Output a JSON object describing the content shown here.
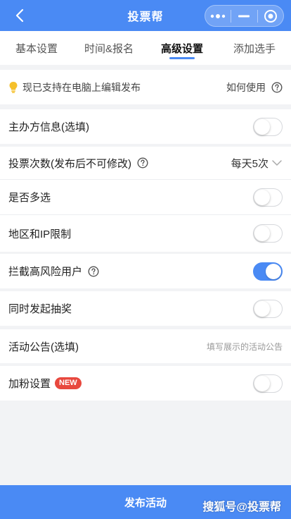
{
  "header": {
    "title": "投票帮",
    "back_icon": "chevron-left-icon",
    "capsule_icons": [
      "more-dots-icon",
      "minimize-icon",
      "close-target-icon"
    ]
  },
  "tabs": [
    {
      "label": "基本设置",
      "active": false
    },
    {
      "label": "时间&报名",
      "active": false
    },
    {
      "label": "高级设置",
      "active": true
    },
    {
      "label": "添加选手",
      "active": false
    }
  ],
  "notice": {
    "text": "现已支持在电脑上编辑发布",
    "link": "如何使用"
  },
  "settings": {
    "organizer": {
      "label": "主办方信息(选填)",
      "on": false
    },
    "vote_count": {
      "label": "投票次数(发布后不可修改)",
      "value": "每天5次"
    },
    "multi": {
      "label": "是否多选",
      "on": false
    },
    "region": {
      "label": "地区和IP限制",
      "on": false
    },
    "risk": {
      "label": "拦截高风险用户",
      "on": true
    },
    "lottery": {
      "label": "同时发起抽奖",
      "on": false
    },
    "announcement": {
      "label": "活动公告(选填)",
      "placeholder": "填写展示的活动公告"
    },
    "fans": {
      "label": "加粉设置",
      "badge": "NEW",
      "on": false
    }
  },
  "footer": {
    "publish": "发布活动",
    "watermark": "搜狐号@投票帮"
  },
  "colors": {
    "brand": "#4a8af4",
    "badge": "#e8483e",
    "background": "#f2f3f5"
  }
}
